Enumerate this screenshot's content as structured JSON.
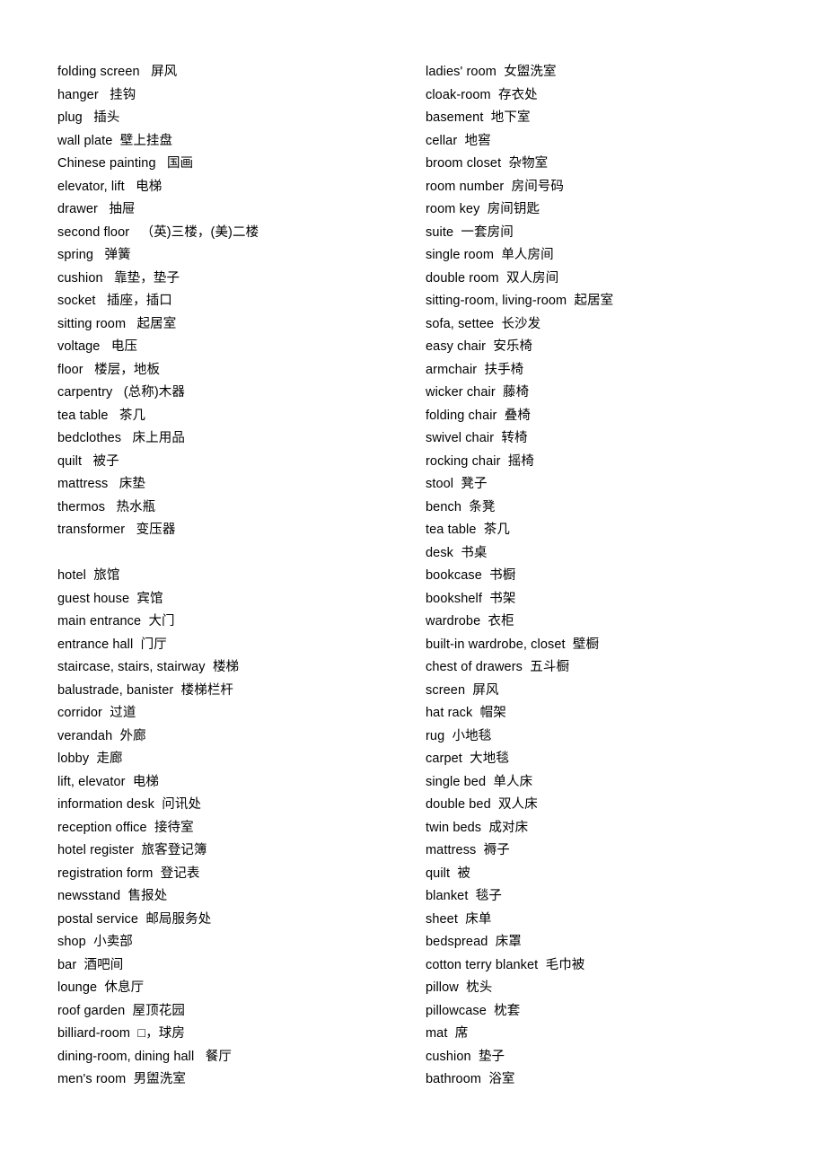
{
  "document": {
    "background_color": "#ffffff",
    "text_color": "#000000",
    "columns": [
      {
        "id": "left-column",
        "entries": [
          {
            "term": "folding screen",
            "sep": "   ",
            "gloss": "屏风"
          },
          {
            "term": "hanger",
            "sep": "   ",
            "gloss": "挂钩"
          },
          {
            "term": "plug",
            "sep": "   ",
            "gloss": "插头"
          },
          {
            "term": "wall plate",
            "sep": "  ",
            "gloss": "壁上挂盘"
          },
          {
            "term": "Chinese painting",
            "sep": "   ",
            "gloss": "国画"
          },
          {
            "term": "elevator, lift",
            "sep": "   ",
            "gloss": "电梯"
          },
          {
            "term": "drawer",
            "sep": "   ",
            "gloss": "抽屉"
          },
          {
            "term": "second floor",
            "sep": "   ",
            "gloss": "（英)三楼，(美)二楼"
          },
          {
            "term": "spring",
            "sep": "   ",
            "gloss": "弹簧"
          },
          {
            "term": "cushion",
            "sep": "   ",
            "gloss": "靠垫，垫子"
          },
          {
            "term": "socket",
            "sep": "   ",
            "gloss": "插座，插口"
          },
          {
            "term": "sitting room",
            "sep": "   ",
            "gloss": "起居室"
          },
          {
            "term": "voltage",
            "sep": "   ",
            "gloss": "电压"
          },
          {
            "term": "floor",
            "sep": "   ",
            "gloss": "楼层，地板"
          },
          {
            "term": "carpentry",
            "sep": "   ",
            "gloss": "(总称)木器"
          },
          {
            "term": "tea table",
            "sep": "   ",
            "gloss": "茶几"
          },
          {
            "term": "bedclothes",
            "sep": "   ",
            "gloss": "床上用品"
          },
          {
            "term": "quilt",
            "sep": "   ",
            "gloss": "被子"
          },
          {
            "term": "mattress",
            "sep": "   ",
            "gloss": "床垫"
          },
          {
            "term": "thermos",
            "sep": "   ",
            "gloss": "热水瓶"
          },
          {
            "term": "transformer",
            "sep": "   ",
            "gloss": "变压器"
          },
          {
            "spacer": true
          },
          {
            "term": "hotel",
            "sep": "  ",
            "gloss": "旅馆"
          },
          {
            "term": "guest house",
            "sep": "  ",
            "gloss": "宾馆"
          },
          {
            "term": "main entrance",
            "sep": "  ",
            "gloss": "大门"
          },
          {
            "term": "entrance hall",
            "sep": "  ",
            "gloss": "门厅"
          },
          {
            "term": "staircase, stairs, stairway",
            "sep": "  ",
            "gloss": "楼梯"
          },
          {
            "term": "balustrade, banister",
            "sep": "  ",
            "gloss": "楼梯栏杆"
          },
          {
            "term": "corridor",
            "sep": "  ",
            "gloss": "过道"
          },
          {
            "term": "verandah",
            "sep": "  ",
            "gloss": "外廊"
          },
          {
            "term": "lobby",
            "sep": "  ",
            "gloss": "走廊"
          },
          {
            "term": "lift, elevator",
            "sep": "  ",
            "gloss": "电梯"
          },
          {
            "term": "information desk",
            "sep": "  ",
            "gloss": "问讯处"
          },
          {
            "term": "reception office",
            "sep": "  ",
            "gloss": "接待室"
          },
          {
            "term": "hotel register",
            "sep": "  ",
            "gloss": "旅客登记簿"
          },
          {
            "term": "registration form",
            "sep": "  ",
            "gloss": "登记表"
          },
          {
            "term": "newsstand",
            "sep": "  ",
            "gloss": "售报处"
          },
          {
            "term": "postal service",
            "sep": "  ",
            "gloss": "邮局服务处"
          },
          {
            "term": "shop",
            "sep": "  ",
            "gloss": "小卖部"
          },
          {
            "term": "bar",
            "sep": "  ",
            "gloss": "酒吧间"
          },
          {
            "term": "lounge",
            "sep": "  ",
            "gloss": "休息厅"
          },
          {
            "term": "roof garden",
            "sep": "  ",
            "gloss": "屋顶花园"
          },
          {
            "term": "billiard-room",
            "sep": "  ",
            "gloss": "□，球房"
          },
          {
            "term": "dining-room, dining hall",
            "sep": "   ",
            "gloss": "餐厅"
          },
          {
            "term": "men's room",
            "sep": "  ",
            "gloss": "男盥洗室"
          }
        ]
      },
      {
        "id": "right-column",
        "entries": [
          {
            "term": "ladies' room",
            "sep": "  ",
            "gloss": "女盥洗室"
          },
          {
            "term": "cloak-room",
            "sep": "  ",
            "gloss": "存衣处"
          },
          {
            "term": "basement",
            "sep": "  ",
            "gloss": "地下室"
          },
          {
            "term": "cellar",
            "sep": "  ",
            "gloss": "地窖"
          },
          {
            "term": "broom closet",
            "sep": "  ",
            "gloss": "杂物室"
          },
          {
            "term": "room number",
            "sep": "  ",
            "gloss": "房间号码"
          },
          {
            "term": "room key",
            "sep": "  ",
            "gloss": "房间钥匙"
          },
          {
            "term": "suite",
            "sep": "  ",
            "gloss": "一套房间"
          },
          {
            "term": "single room",
            "sep": "  ",
            "gloss": "单人房间"
          },
          {
            "term": "double room",
            "sep": "  ",
            "gloss": "双人房间"
          },
          {
            "term": "sitting-room, living-room",
            "sep": "  ",
            "gloss": "起居室"
          },
          {
            "term": "sofa, settee",
            "sep": "  ",
            "gloss": "长沙发"
          },
          {
            "term": "easy chair",
            "sep": "  ",
            "gloss": "安乐椅"
          },
          {
            "term": "armchair",
            "sep": "  ",
            "gloss": "扶手椅"
          },
          {
            "term": "wicker chair",
            "sep": "  ",
            "gloss": "藤椅"
          },
          {
            "term": "folding chair",
            "sep": "  ",
            "gloss": "叠椅"
          },
          {
            "term": "swivel chair",
            "sep": "  ",
            "gloss": "转椅"
          },
          {
            "term": "rocking chair",
            "sep": "  ",
            "gloss": "摇椅"
          },
          {
            "term": "stool",
            "sep": "  ",
            "gloss": "凳子"
          },
          {
            "term": "bench",
            "sep": "  ",
            "gloss": "条凳"
          },
          {
            "term": "tea table",
            "sep": "  ",
            "gloss": "茶几"
          },
          {
            "term": "desk",
            "sep": "  ",
            "gloss": "书桌"
          },
          {
            "term": "bookcase",
            "sep": "  ",
            "gloss": "书橱"
          },
          {
            "term": "bookshelf",
            "sep": "  ",
            "gloss": "书架"
          },
          {
            "term": "wardrobe",
            "sep": "  ",
            "gloss": "衣柜"
          },
          {
            "term": "built-in wardrobe, closet",
            "sep": "  ",
            "gloss": "壁橱"
          },
          {
            "term": "chest of drawers",
            "sep": "  ",
            "gloss": "五斗橱"
          },
          {
            "term": "screen",
            "sep": "  ",
            "gloss": "屏风"
          },
          {
            "term": "hat rack",
            "sep": "  ",
            "gloss": "帽架"
          },
          {
            "term": "rug",
            "sep": "  ",
            "gloss": "小地毯"
          },
          {
            "term": "carpet",
            "sep": "  ",
            "gloss": "大地毯"
          },
          {
            "term": "single bed",
            "sep": "  ",
            "gloss": "单人床"
          },
          {
            "term": "double bed",
            "sep": "  ",
            "gloss": "双人床"
          },
          {
            "term": "twin beds",
            "sep": "  ",
            "gloss": "成对床"
          },
          {
            "term": "mattress",
            "sep": "  ",
            "gloss": "褥子"
          },
          {
            "term": "quilt",
            "sep": "  ",
            "gloss": "被"
          },
          {
            "term": "blanket",
            "sep": "  ",
            "gloss": "毯子"
          },
          {
            "term": "sheet",
            "sep": "  ",
            "gloss": "床单"
          },
          {
            "term": "bedspread",
            "sep": "  ",
            "gloss": "床罩"
          },
          {
            "term": "cotton terry blanket",
            "sep": "  ",
            "gloss": "毛巾被"
          },
          {
            "term": "pillow",
            "sep": "  ",
            "gloss": "枕头"
          },
          {
            "term": "pillowcase",
            "sep": "  ",
            "gloss": "枕套"
          },
          {
            "term": "mat",
            "sep": "  ",
            "gloss": "席"
          },
          {
            "term": "cushion",
            "sep": "  ",
            "gloss": "垫子"
          },
          {
            "term": "bathroom",
            "sep": "  ",
            "gloss": "浴室"
          }
        ]
      }
    ]
  }
}
